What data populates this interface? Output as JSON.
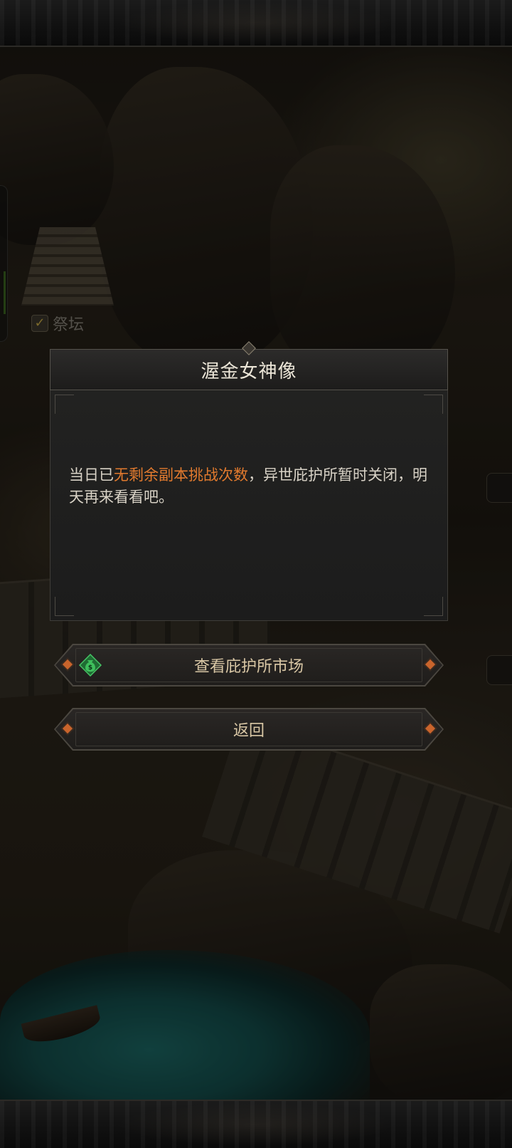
{
  "scene": {
    "map_labels": [
      {
        "text": "祭坛",
        "checked": true
      }
    ]
  },
  "dialog": {
    "title": "渥金女神像",
    "message_before": "当日已",
    "message_highlight": "无剩余副本挑战次数",
    "message_after": "，异世庇护所暂时关闭，明天再来看看吧。",
    "highlight_color": "#e27a2e"
  },
  "buttons": {
    "market_label": "查看庇护所市场",
    "market_icon": "money-bag-icon",
    "back_label": "返回"
  }
}
